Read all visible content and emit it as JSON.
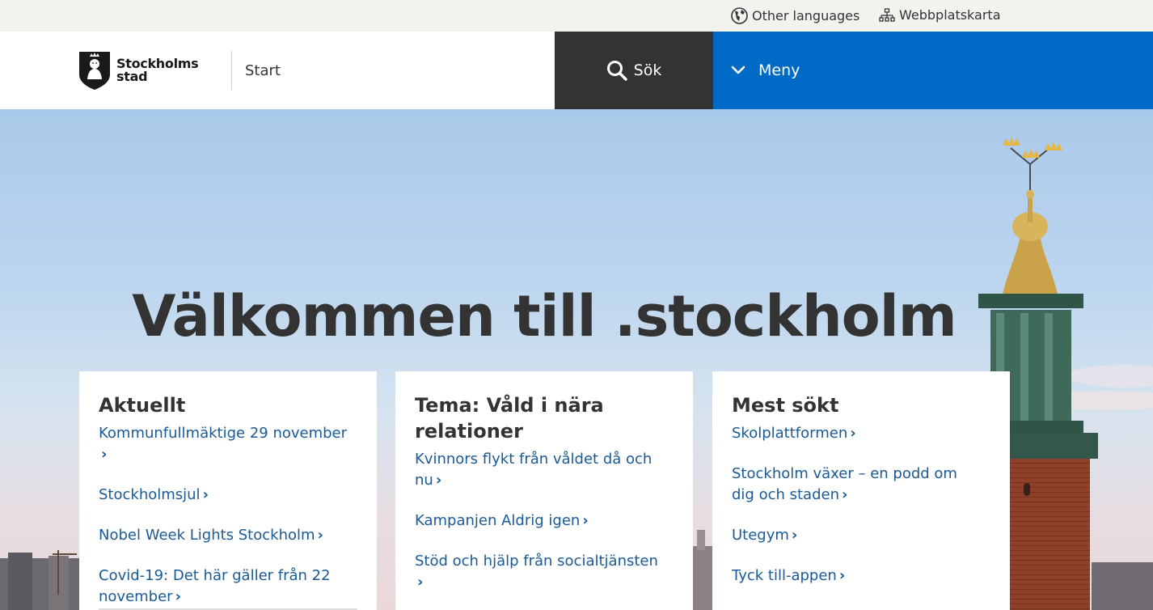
{
  "utility": {
    "languages_label": "Other languages",
    "sitemap_label": "Webbplatskarta"
  },
  "header": {
    "logo_line1": "Stockholms",
    "logo_line2": "stad",
    "breadcrumb": "Start",
    "search_label": "Sök",
    "menu_label": "Meny"
  },
  "hero": {
    "title": "Välkommen till .stockholm"
  },
  "cards": [
    {
      "heading": "Aktuellt",
      "links": [
        "Kommunfullmäktige 29 november",
        "Stockholmsjul",
        "Nobel Week Lights Stockholm",
        "Covid-19: Det här gäller från 22 november"
      ]
    },
    {
      "heading": "Tema: Våld i nära relationer",
      "links": [
        "Kvinnors flykt från våldet då och nu",
        "Kampanjen Aldrig igen",
        "Stöd och hjälp från socialtjänsten"
      ]
    },
    {
      "heading": "Mest sökt",
      "links": [
        "Skolplattformen",
        "Stockholm växer – en podd om dig och staden",
        "Utegym",
        "Tyck till-appen"
      ]
    }
  ],
  "colors": {
    "menu_blue": "#006ac7",
    "search_dark": "#333333",
    "link_blue": "#1a5a96",
    "utility_bg": "#f3f2ef"
  }
}
